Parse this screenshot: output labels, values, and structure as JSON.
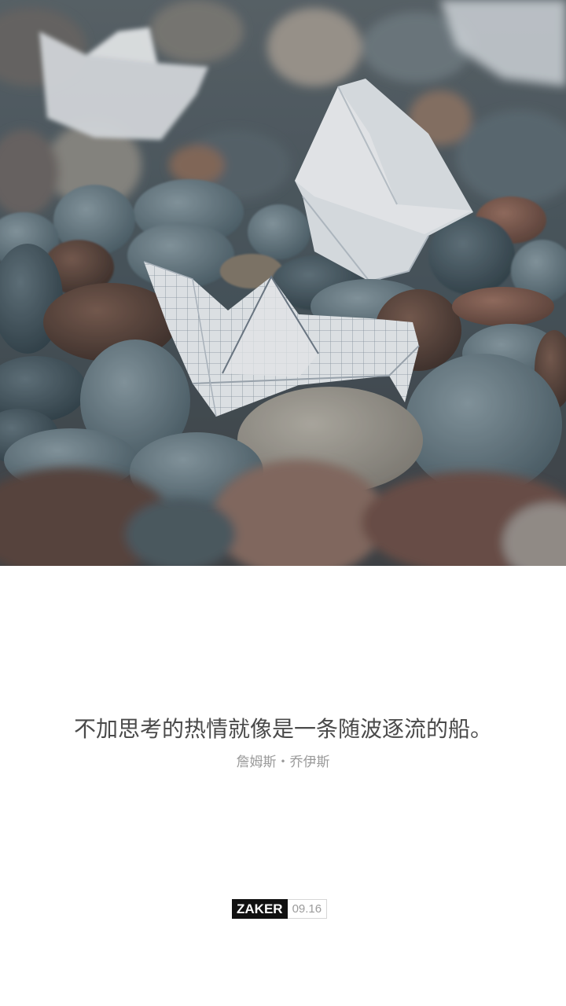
{
  "hero": {
    "description_icon": "paper-boats-on-pebbles-photo"
  },
  "quote": {
    "text": "不加思考的热情就像是一条随波逐流的船。",
    "author": "詹姆斯・乔伊斯"
  },
  "brand": {
    "name": "ZAKER",
    "date": "09.16"
  }
}
